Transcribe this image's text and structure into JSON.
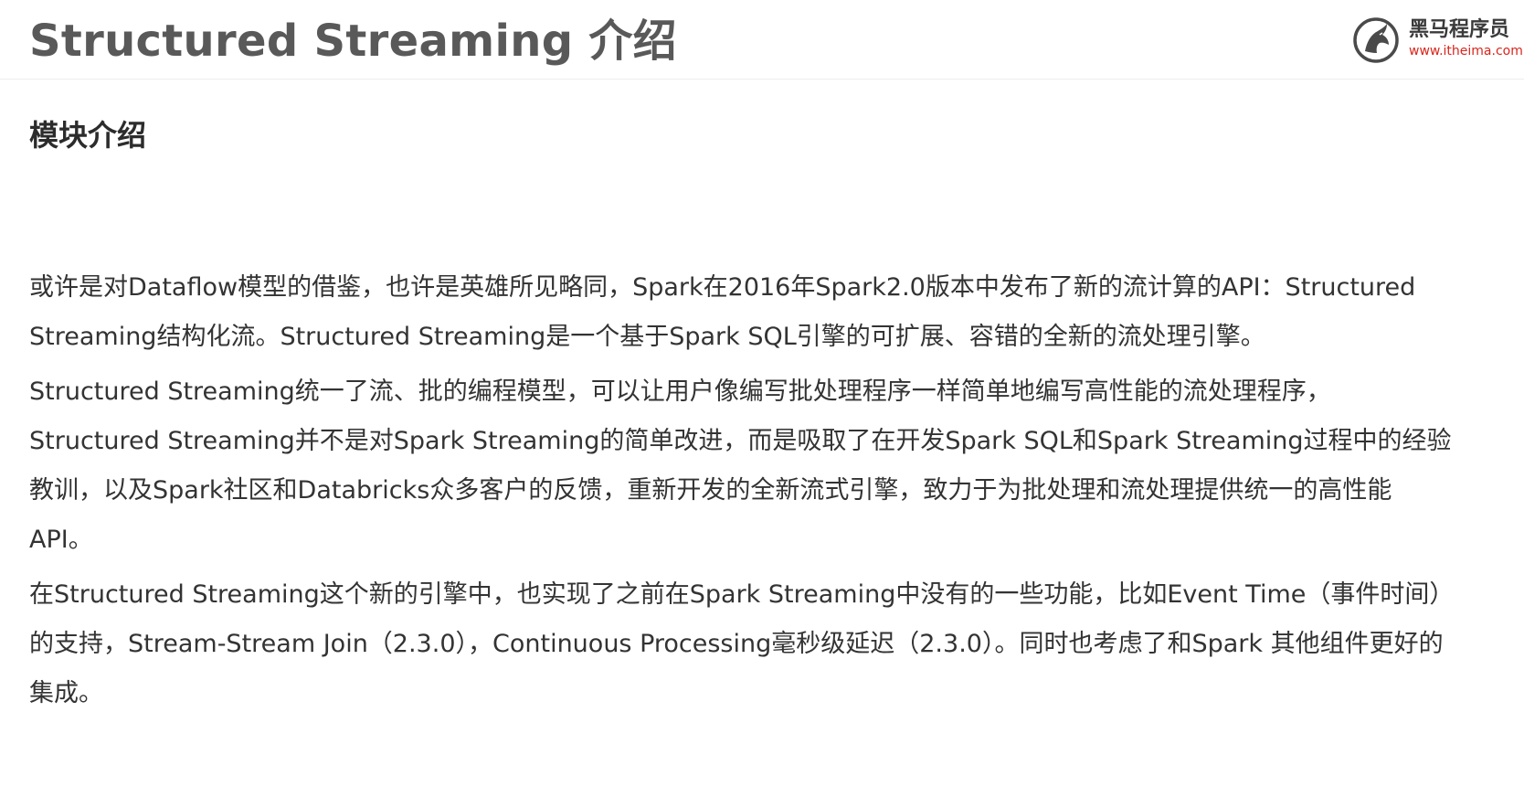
{
  "header": {
    "title": "Structured Streaming 介绍",
    "brand_name": "黑马程序员",
    "brand_url": "www.itheima.com",
    "brand_icon": "horse-logo-icon",
    "colors": {
      "brand_red": "#d9251c",
      "logo_gray": "#4a4a4a"
    }
  },
  "section": {
    "heading": "模块介绍"
  },
  "paragraphs": [
    "或许是对Dataflow模型的借鉴，也许是英雄所见略同，Spark在2016年Spark2.0版本中发布了新的流计算的API：Structured Streaming结构化流。Structured Streaming是一个基于Spark SQL引擎的可扩展、容错的全新的流处理引擎。",
    "Structured Streaming统一了流、批的编程模型，可以让用户像编写批处理程序一样简单地编写高性能的流处理程序，Structured Streaming并不是对Spark Streaming的简单改进，而是吸取了在开发Spark SQL和Spark Streaming过程中的经验教训，以及Spark社区和Databricks众多客户的反馈，重新开发的全新流式引擎，致力于为批处理和流处理提供统一的高性能API。",
    "在Structured Streaming这个新的引擎中，也实现了之前在Spark Streaming中没有的一些功能，比如Event Time（事件时间）的支持，Stream-Stream Join（2.3.0），Continuous Processing毫秒级延迟（2.3.0）。同时也考虑了和Spark 其他组件更好的集成。"
  ]
}
